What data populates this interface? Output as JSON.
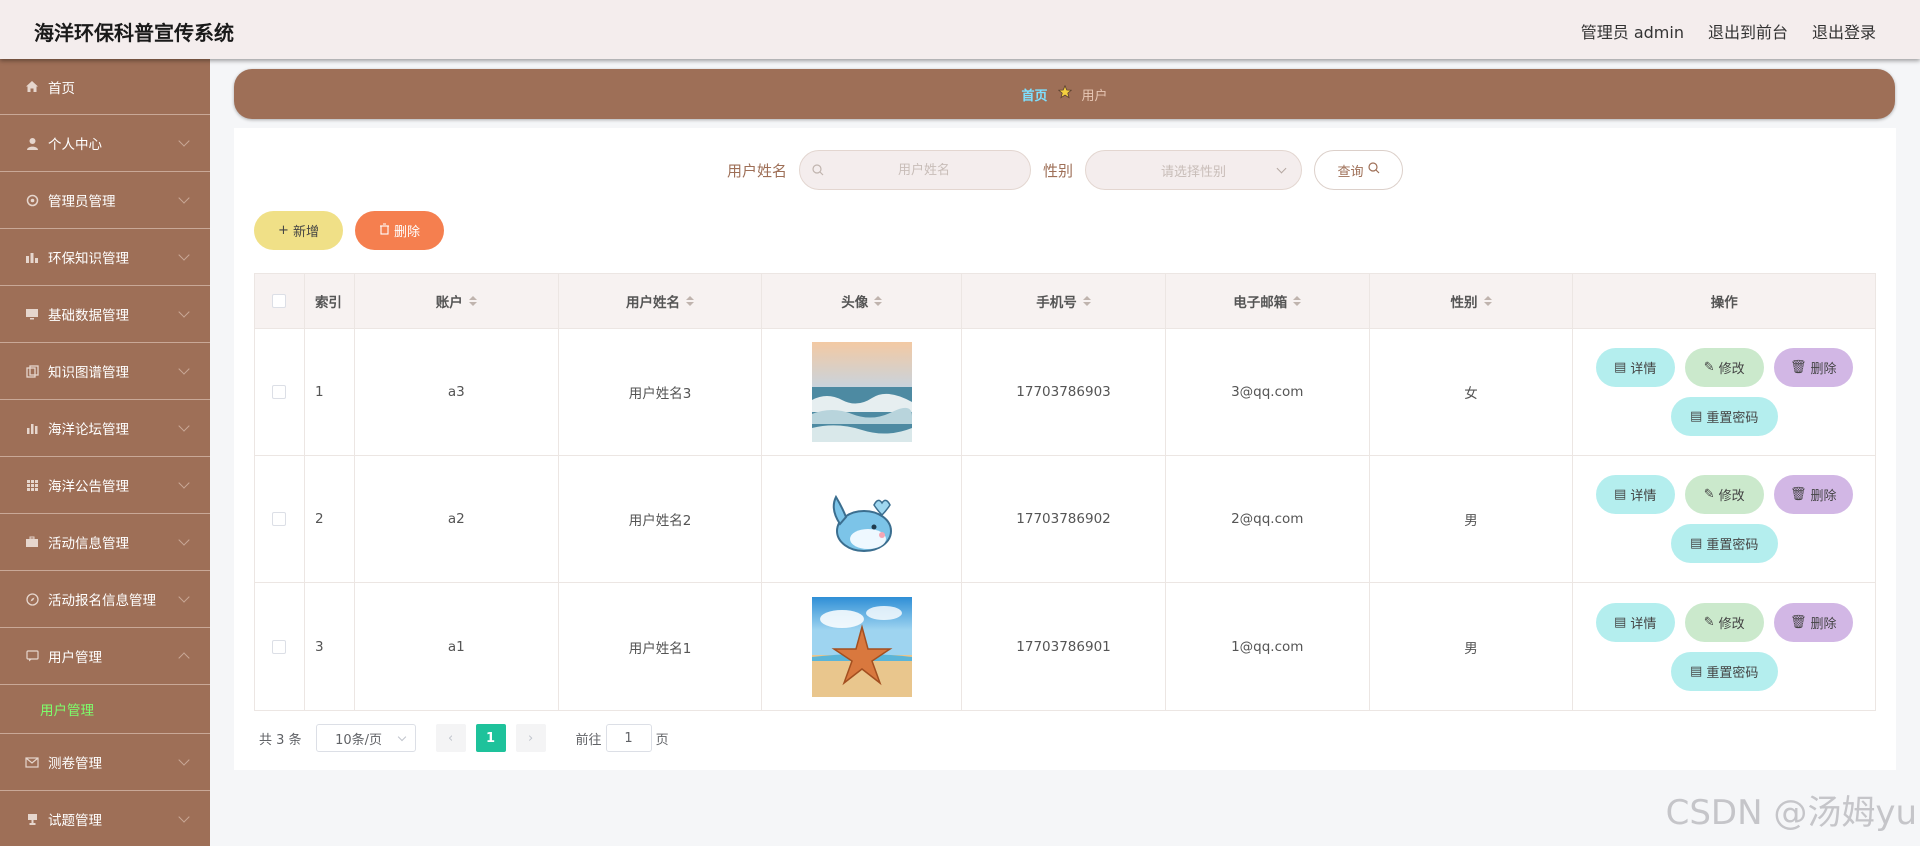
{
  "header": {
    "title": "海洋环保科普宣传系统",
    "admin_label": "管理员 admin",
    "to_front_label": "退出到前台",
    "logout_label": "退出登录"
  },
  "sidebar": {
    "items": [
      {
        "label": "首页",
        "icon": "home-icon"
      },
      {
        "label": "个人中心",
        "icon": "user-icon"
      },
      {
        "label": "管理员管理",
        "icon": "gear-icon"
      },
      {
        "label": "环保知识管理",
        "icon": "chart-icon"
      },
      {
        "label": "基础数据管理",
        "icon": "monitor-icon"
      },
      {
        "label": "知识图谱管理",
        "icon": "copy-icon"
      },
      {
        "label": "海洋论坛管理",
        "icon": "bar-chart-icon"
      },
      {
        "label": "海洋公告管理",
        "icon": "grid-icon"
      },
      {
        "label": "活动信息管理",
        "icon": "briefcase-icon"
      },
      {
        "label": "活动报名信息管理",
        "icon": "compass-icon"
      },
      {
        "label": "用户管理",
        "icon": "chat-icon"
      },
      {
        "label": "测卷管理",
        "icon": "mail-icon"
      },
      {
        "label": "试题管理",
        "icon": "trophy-icon"
      }
    ],
    "sub_item": "用户管理"
  },
  "breadcrumb": {
    "home": "首页",
    "current": "用户"
  },
  "search": {
    "name_label": "用户姓名",
    "name_placeholder": "用户姓名",
    "gender_label": "性别",
    "gender_placeholder": "请选择性别",
    "query_label": "查询"
  },
  "actions": {
    "add_label": "新增",
    "delete_label": "删除"
  },
  "table": {
    "headers": [
      "索引",
      "账户",
      "用户姓名",
      "头像",
      "手机号",
      "电子邮箱",
      "性别",
      "操作"
    ],
    "rows": [
      {
        "index": "1",
        "account": "a3",
        "name": "用户姓名3",
        "avatar": "ocean-wave",
        "phone": "17703786903",
        "email": "3@qq.com",
        "gender": "女"
      },
      {
        "index": "2",
        "account": "a2",
        "name": "用户姓名2",
        "avatar": "cartoon-whale",
        "phone": "17703786902",
        "email": "2@qq.com",
        "gender": "男"
      },
      {
        "index": "3",
        "account": "a1",
        "name": "用户姓名1",
        "avatar": "starfish-beach",
        "phone": "17703786901",
        "email": "1@qq.com",
        "gender": "男"
      }
    ],
    "op_labels": {
      "detail": "详情",
      "edit": "修改",
      "delete": "删除",
      "reset": "重置密码"
    }
  },
  "pagination": {
    "total": "共 3 条",
    "page_size": "10条/页",
    "current_page": "1",
    "goto_label": "前往",
    "goto_value": "1",
    "page_suffix": "页"
  },
  "watermark": "CSDN @汤姆yu",
  "colors": {
    "sidebar": "#9e6f57",
    "accent_green": "#1ec29b",
    "add_btn": "#f0e087",
    "delete_btn": "#f57f4f"
  }
}
